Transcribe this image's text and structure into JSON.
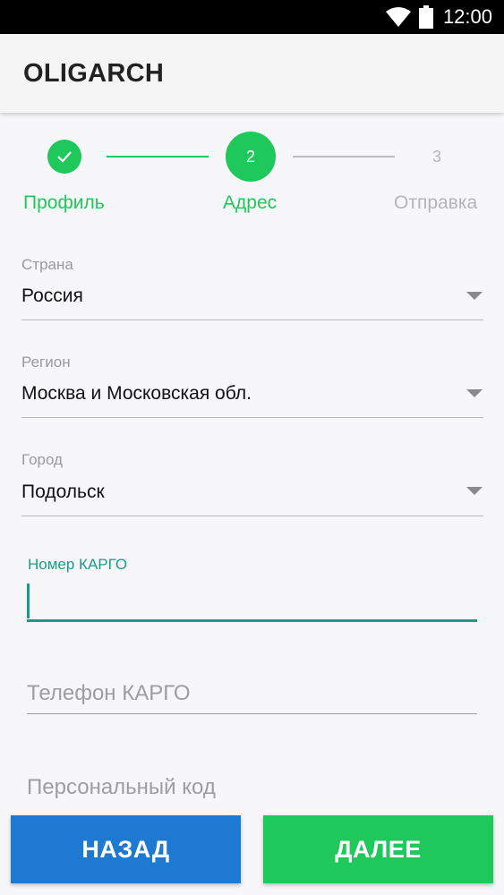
{
  "status_bar": {
    "time": "12:00",
    "wifi_icon": "wifi-icon",
    "battery_icon": "battery-icon"
  },
  "app_bar": {
    "title": "OLIGARCH"
  },
  "stepper": {
    "steps": [
      {
        "number": "1",
        "label": "Профиль",
        "state": "completed",
        "icon": "check-icon"
      },
      {
        "number": "2",
        "label": "Адрес",
        "state": "active"
      },
      {
        "number": "3",
        "label": "Отправка",
        "state": "inactive"
      }
    ],
    "colors": {
      "active": "#1ec85a",
      "inactive": "#b5b5b5"
    }
  },
  "form": {
    "country": {
      "label": "Страна",
      "value": "Россия"
    },
    "region": {
      "label": "Регион",
      "value": "Москва и Московская обл."
    },
    "city": {
      "label": "Город",
      "value": "Подольск"
    },
    "cargo_number": {
      "label": "Номер КАРГО",
      "value": ""
    },
    "cargo_phone": {
      "placeholder": "Телефон КАРГО",
      "value": ""
    },
    "personal_code": {
      "placeholder": "Персональный код",
      "value": ""
    }
  },
  "buttons": {
    "back": "НАЗАД",
    "next": "ДАЛЕЕ"
  },
  "colors": {
    "accent_teal": "#1b9a8a",
    "back_button": "#1e79d3",
    "next_button": "#1ec85a"
  }
}
